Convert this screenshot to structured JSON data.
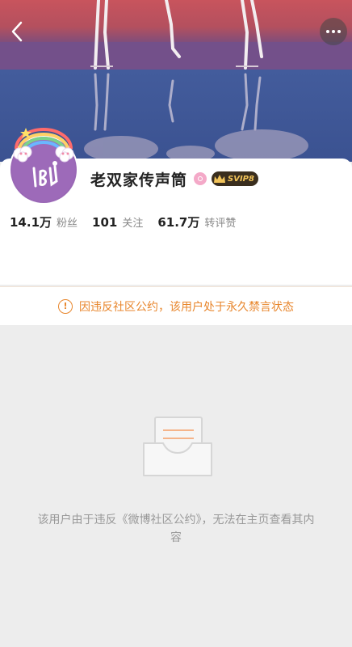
{
  "profile": {
    "name": "老双家传声筒",
    "vip_label": "SVIP8"
  },
  "stats": [
    {
      "value": "14.1万",
      "label": "粉丝"
    },
    {
      "value": "101",
      "label": "关注"
    },
    {
      "value": "61.7万",
      "label": "转评赞"
    }
  ],
  "notice": {
    "icon": "warning-icon",
    "text": "因违反社区公约，该用户处于永久禁言状态"
  },
  "empty_state": {
    "icon": "empty-inbox-icon",
    "text": "该用户由于违反《微博社区公约》，无法在主页查看其内容"
  },
  "colors": {
    "warning": "#e8862c",
    "page_bg": "#ededed"
  }
}
